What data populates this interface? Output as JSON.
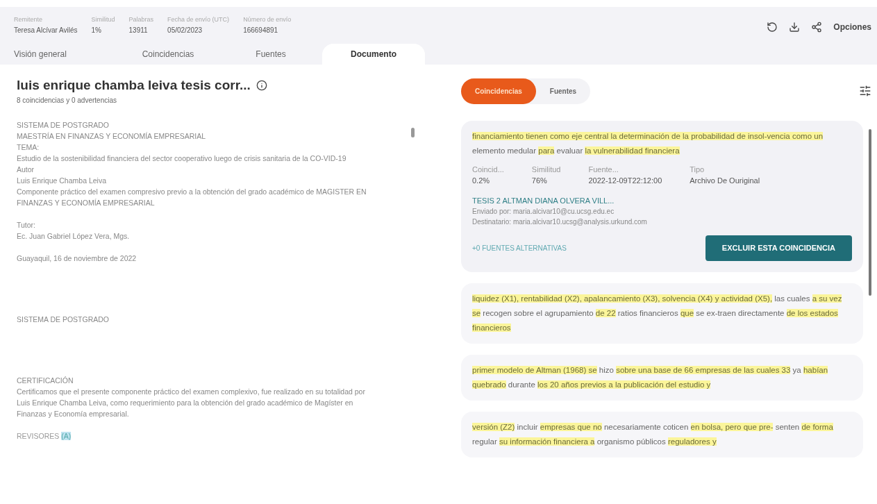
{
  "meta": [
    {
      "label": "Remitente",
      "value": "Teresa Alcívar Avilés"
    },
    {
      "label": "Similitud",
      "value": "1%"
    },
    {
      "label": "Palabras",
      "value": "13911"
    },
    {
      "label": "Fecha de envío (UTC)",
      "value": "05/02/2023"
    },
    {
      "label": "Número de envío",
      "value": "166694891"
    }
  ],
  "actions": {
    "options_label": "Opciones"
  },
  "tabs": [
    {
      "label": "Visión general",
      "selected": false
    },
    {
      "label": "Coincidencias",
      "selected": false
    },
    {
      "label": "Fuentes",
      "selected": false
    },
    {
      "label": "Documento",
      "selected": true
    }
  ],
  "document": {
    "title": "luis enrique chamba leiva tesis corr...",
    "subtitle": "8 coincidencias y 0 advertencias",
    "blocks": [
      {
        "lines": [
          "SISTEMA DE POSTGRADO",
          "MAESTRÍA EN FINANZAS Y ECONOMÍA EMPRESARIAL",
          "TEMA:",
          "Estudio de la sostenibilidad financiera del sector cooperativo luego de crisis sanitaria de la CO-VID-19",
          "Autor",
          "Luis Enrique Chamba Leiva",
          "Componente práctico del examen compresivo previo a la obtención del grado académico de MAGISTER EN FINANZAS Y ECONOMÍA EMPRESARIAL"
        ]
      },
      {
        "lines": [
          "Tutor:",
          "Ec. Juan Gabriel López Vera, Mgs."
        ]
      },
      {
        "lines": [
          "Guayaquil, 16 de noviembre de 2022"
        ]
      },
      {
        "kind": "gap"
      },
      {
        "lines": [
          "SISTEMA DE POSTGRADO"
        ]
      },
      {
        "kind": "gap"
      },
      {
        "lines": [
          "CERTIFICACIÓN",
          "Certificamos que el presente componente práctico del examen complexivo, fue realizado en su totalidad por Luis Enrique Chamba Leiva, como requerimiento para la obtención del grado académico de Magíster en Finanzas y Economía empresarial."
        ]
      }
    ],
    "marked_line": {
      "text": "REVISORES",
      "mark": "(A)"
    }
  },
  "view_toggle": [
    {
      "label": "Coincidencias",
      "selected": true
    },
    {
      "label": "Fuentes",
      "selected": false
    }
  ],
  "matches": [
    {
      "expanded": true,
      "segments": [
        {
          "text": "financiamiento tienen como eje central la determinación de la probabilidad de insol-vencia como un",
          "highlighted": true
        },
        {
          "text": "elemento medular",
          "highlighted": false
        },
        {
          "text": "para",
          "highlighted": true
        },
        {
          "text": "evaluar",
          "highlighted": false
        },
        {
          "text": "la vulnerabilidad financiera",
          "highlighted": true
        }
      ],
      "fields": [
        {
          "label": "Coincid...",
          "value": "0.2%"
        },
        {
          "label": "Similitud",
          "value": "76%"
        },
        {
          "label": "Fuente...",
          "value": "2022-12-09T22:12:00"
        },
        {
          "label": "Tipo",
          "value": "Archivo De Ouriginal"
        }
      ],
      "source_title": "TESIS 2 ALTMAN DIANA OLVERA VILL...",
      "sender": "Enviado por: maria.alcivar10@cu.ucsg.edu.ec",
      "recipient": "Destinatario: maria.alcivar10.ucsg@analysis.urkund.com",
      "alternatives": {
        "label": "+0 FUENTES ALTERNATIVAS",
        "disabled": true
      },
      "exclude_button": "EXCLUIR ESTA COINCIDENCIA"
    },
    {
      "expanded": false,
      "segments": [
        {
          "text": "liquidez (X1), rentabilidad (X2), apalancamiento (X3), solvencia (X4) y actividad (X5),",
          "highlighted": true
        },
        {
          "text": "las cuales",
          "highlighted": false
        },
        {
          "text": "a su vez se",
          "highlighted": true
        },
        {
          "text": "recogen sobre el agrupamiento",
          "highlighted": false
        },
        {
          "text": "de 22",
          "highlighted": true
        },
        {
          "text": "ratios financieros",
          "highlighted": false
        },
        {
          "text": "que",
          "highlighted": true
        },
        {
          "text": "se ex-traen directamente",
          "highlighted": false
        },
        {
          "text": "de los estados financieros",
          "highlighted": true
        }
      ]
    },
    {
      "expanded": false,
      "segments": [
        {
          "text": "primer modelo de Altman (1968) se",
          "highlighted": true
        },
        {
          "text": "hizo",
          "highlighted": false
        },
        {
          "text": "sobre una base de 66 empresas de las cuales 33",
          "highlighted": true
        },
        {
          "text": "ya",
          "highlighted": false
        },
        {
          "text": "habían quebrado",
          "highlighted": true
        },
        {
          "text": "durante",
          "highlighted": false
        },
        {
          "text": "los 20 años previos a la publicación del estudio y",
          "highlighted": true
        }
      ]
    },
    {
      "expanded": false,
      "segments": [
        {
          "text": "versión (Z2)",
          "highlighted": true
        },
        {
          "text": "incluir",
          "highlighted": false
        },
        {
          "text": "empresas que no",
          "highlighted": true
        },
        {
          "text": "necesariamente coticen",
          "highlighted": false
        },
        {
          "text": "en bolsa, pero que pre-",
          "highlighted": true
        },
        {
          "text": "senten",
          "highlighted": false
        },
        {
          "text": "de forma",
          "highlighted": true
        },
        {
          "text": "regular",
          "highlighted": false
        },
        {
          "text": "su información financiera a",
          "highlighted": true
        },
        {
          "text": "organismo públicos",
          "highlighted": false
        },
        {
          "text": "reguladores y",
          "highlighted": true
        }
      ]
    }
  ]
}
